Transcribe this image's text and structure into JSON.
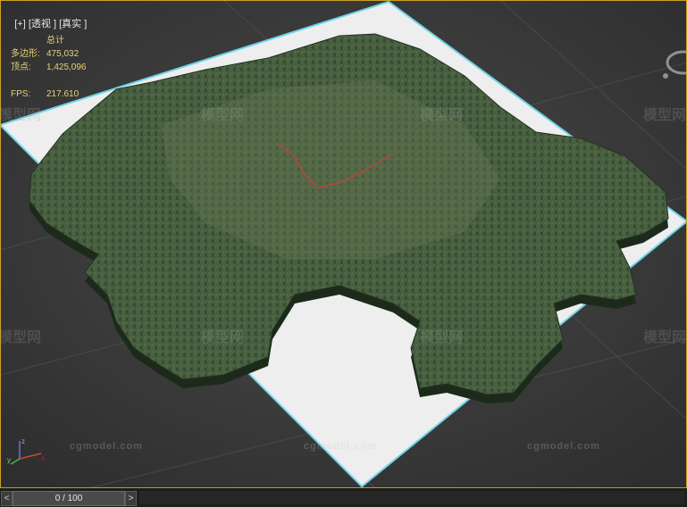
{
  "viewport": {
    "menu": {
      "plus": "[+]",
      "view": "[透视 ]",
      "shading": "[真实 ]"
    },
    "stats": {
      "header": "总计",
      "polygons_label": "多边形:",
      "polygons_value": "475,032",
      "vertices_label": "顶点:",
      "vertices_value": "1,425,096",
      "fps_label": "FPS:",
      "fps_value": "217.610"
    },
    "watermark_text": "模型网",
    "watermark_url": "cgmodel.com",
    "gizmo_axes": [
      "x",
      "y",
      "z"
    ]
  },
  "timeline": {
    "prev": "<",
    "next": ">",
    "frame_label": "0 / 100",
    "current_frame": 0,
    "total_frames": 100
  },
  "colors": {
    "viewport_bg": "#3a3a3a",
    "border_accent": "#c9a227",
    "stats_text": "#e7d27a",
    "terrain": "#3f5a38",
    "ground_plane": "#eeeeee",
    "route": "#b5483a"
  }
}
